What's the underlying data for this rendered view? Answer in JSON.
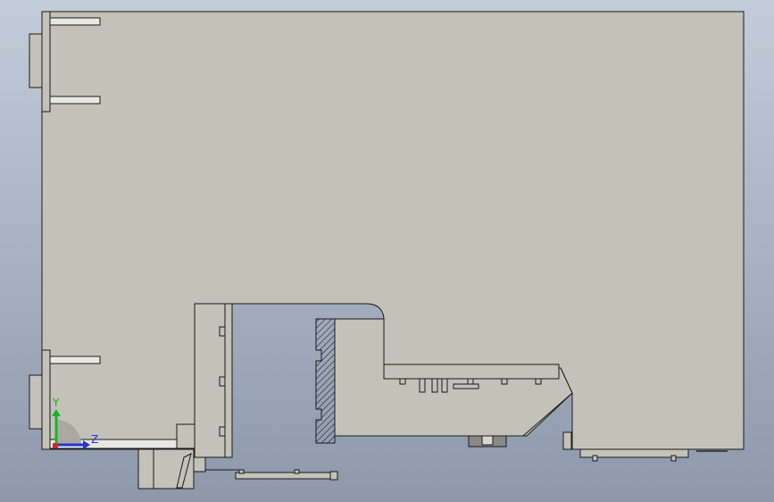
{
  "viewport": {
    "background_top": "#c3ccd9",
    "background_bottom": "#8d98ab",
    "part_fill": "#c2c2b8",
    "edge_color": "#1a1a1a"
  },
  "triad": {
    "y_label": "Y",
    "z_label": "Z",
    "y_color": "#1fb31f",
    "z_color": "#2233dd",
    "x_color": "#dd2222",
    "icon": "coordinate-triad-icon"
  }
}
